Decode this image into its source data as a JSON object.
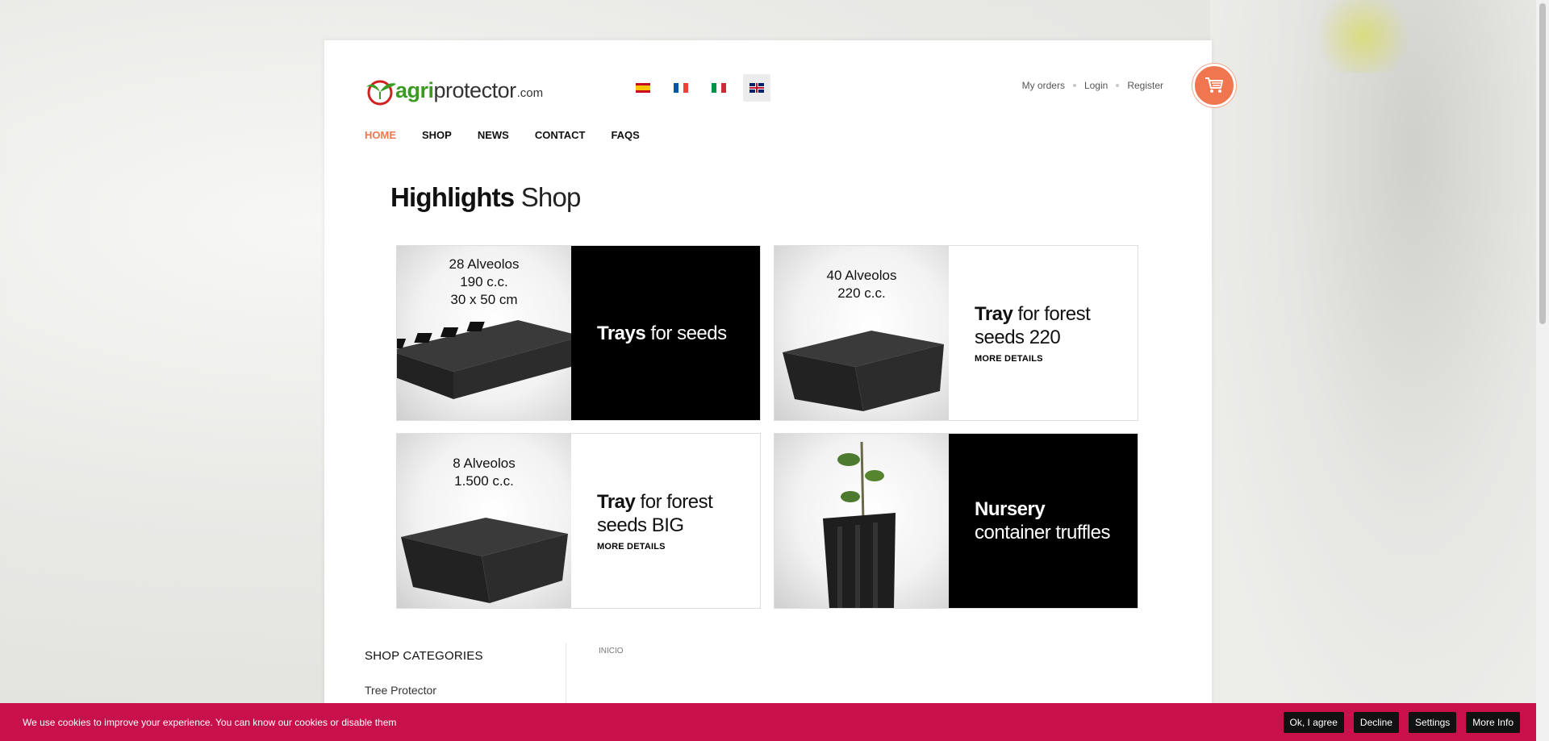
{
  "brand": {
    "part1": "agri",
    "part2": "protector",
    "part3": ".com"
  },
  "languages": [
    {
      "code": "es",
      "icon": "spain-flag-icon"
    },
    {
      "code": "fr",
      "icon": "france-flag-icon"
    },
    {
      "code": "it",
      "icon": "italy-flag-icon"
    },
    {
      "code": "en",
      "icon": "uk-flag-icon",
      "active": true
    }
  ],
  "toplinks": {
    "orders": "My orders",
    "login": "Login",
    "register": "Register"
  },
  "nav": {
    "home": "HOME",
    "shop": "SHOP",
    "news": "NEWS",
    "contact": "CONTACT",
    "faqs": "FAQS"
  },
  "highlights": {
    "bold": "Highlights",
    "normal": "Shop"
  },
  "tiles": [
    {
      "caption": [
        "28 Alveolos",
        "190 c.c.",
        "30 x 50 cm"
      ],
      "title_bold": "Trays",
      "title_rest": "for seeds",
      "more": ""
    },
    {
      "caption": [
        "40 Alveolos",
        "220 c.c."
      ],
      "title_bold": "Tray",
      "title_rest": "for forest seeds 220",
      "more": "MORE DETAILS"
    },
    {
      "caption": [
        "8 Alveolos",
        "1.500 c.c."
      ],
      "title_bold": "Tray",
      "title_rest": "for forest seeds BIG",
      "more": "MORE DETAILS"
    },
    {
      "caption": [],
      "title_bold": "Nursery",
      "title_rest": "container truffles",
      "more": ""
    }
  ],
  "sidebar": {
    "heading": "SHOP CATEGORIES",
    "first_item": "Tree Protector"
  },
  "breadcrumb": "INICIO",
  "cookie": {
    "message": "We use cookies to improve your experience. You can know our cookies or disable them",
    "agree": "Ok, I agree",
    "decline": "Decline",
    "settings": "Settings",
    "more": "More Info"
  },
  "colors": {
    "accent": "#f07650",
    "brand_green": "#3a9a22",
    "cookie_bar": "#c8104a"
  }
}
